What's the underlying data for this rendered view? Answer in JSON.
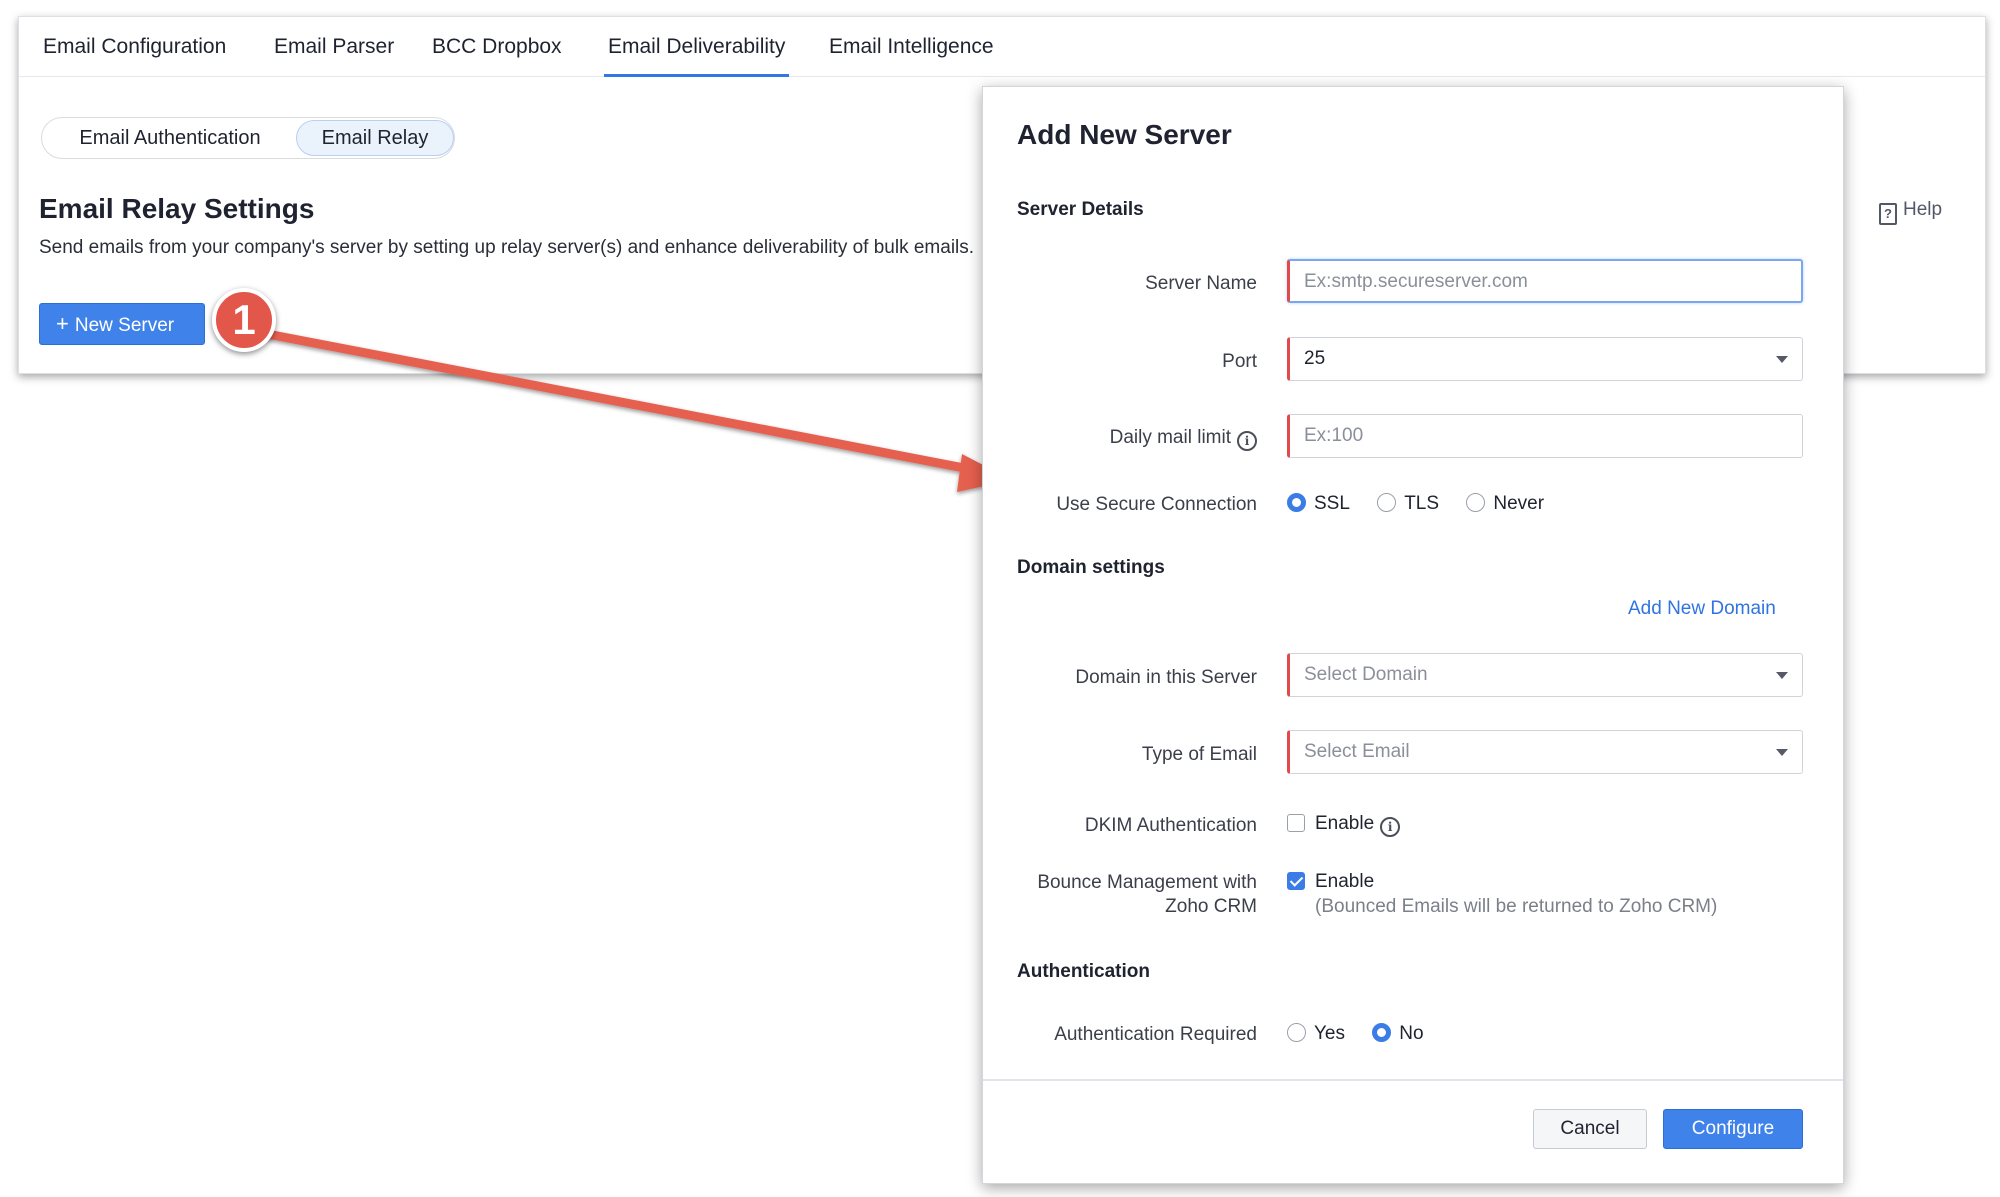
{
  "tabs": [
    {
      "label": "Email Configuration"
    },
    {
      "label": "Email Parser"
    },
    {
      "label": "BCC Dropbox"
    },
    {
      "label": "Email Deliverability",
      "active": true
    },
    {
      "label": "Email Intelligence"
    }
  ],
  "segment": {
    "items": [
      {
        "label": "Email Authentication"
      },
      {
        "label": "Email Relay",
        "active": true
      }
    ]
  },
  "relay": {
    "title": "Email Relay Settings",
    "description": "Send emails from your company's server by setting up relay server(s) and enhance deliverability of bulk emails.",
    "new_server_label": "New Server",
    "help_label": "Help"
  },
  "step_badge": "1",
  "modal": {
    "title": "Add New Server",
    "server_details": {
      "heading": "Server Details",
      "server_name_label": "Server Name",
      "server_name_placeholder": "Ex:smtp.secureserver.com",
      "port_label": "Port",
      "port_value": "25",
      "daily_limit_label": "Daily mail limit",
      "daily_limit_placeholder": "Ex:100",
      "secure_label": "Use Secure Connection",
      "secure_options": [
        "SSL",
        "TLS",
        "Never"
      ],
      "secure_selected": "SSL"
    },
    "domain_settings": {
      "heading": "Domain settings",
      "add_domain_link": "Add New Domain",
      "domain_label": "Domain in this Server",
      "domain_placeholder": "Select Domain",
      "email_type_label": "Type of Email",
      "email_type_placeholder": "Select Email",
      "dkim_label": "DKIM Authentication",
      "dkim_option": "Enable",
      "dkim_checked": false,
      "bounce_label_line1": "Bounce Management with",
      "bounce_label_line2": "Zoho CRM",
      "bounce_option": "Enable",
      "bounce_checked": true,
      "bounce_note": "(Bounced Emails will be returned to Zoho CRM)"
    },
    "authentication": {
      "heading": "Authentication",
      "required_label": "Authentication Required",
      "options": [
        "Yes",
        "No"
      ],
      "selected": "No"
    },
    "cancel_label": "Cancel",
    "configure_label": "Configure"
  },
  "colors": {
    "accent": "#3e82ea",
    "required_marker": "#e04a4a",
    "annotation": "#e2574a"
  }
}
